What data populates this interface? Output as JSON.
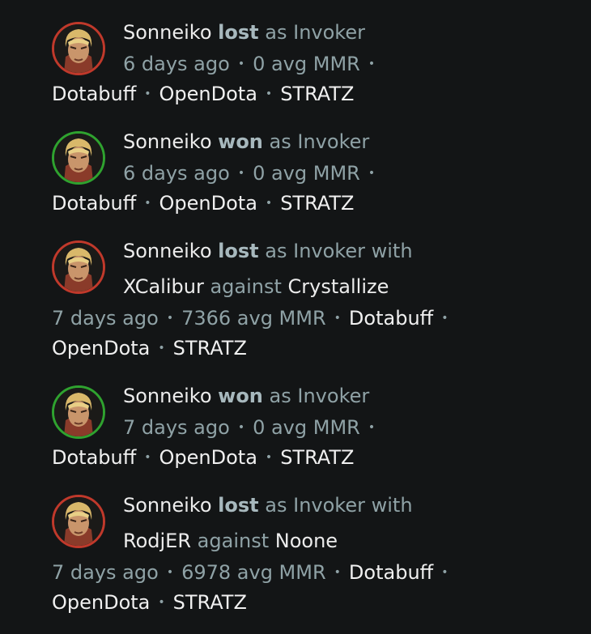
{
  "matches": [
    {
      "player": "Sonneiko",
      "result": "lost",
      "as_text": "as",
      "hero": "Invoker",
      "with_text": "",
      "ally": "",
      "against_text": "",
      "opponent": "",
      "time": "6 days ago",
      "mmr": "0 avg MMR",
      "links": [
        "Dotabuff",
        "OpenDota",
        "STRATZ"
      ]
    },
    {
      "player": "Sonneiko",
      "result": "won",
      "as_text": "as",
      "hero": "Invoker",
      "with_text": "",
      "ally": "",
      "against_text": "",
      "opponent": "",
      "time": "6 days ago",
      "mmr": "0 avg MMR",
      "links": [
        "Dotabuff",
        "OpenDota",
        "STRATZ"
      ]
    },
    {
      "player": "Sonneiko",
      "result": "lost",
      "as_text": "as",
      "hero": "Invoker",
      "with_text": "with",
      "ally": "XCalibur",
      "against_text": "against",
      "opponent": "Crystallize",
      "time": "7 days ago",
      "mmr": "7366 avg MMR",
      "links": [
        "Dotabuff",
        "OpenDota",
        "STRATZ"
      ]
    },
    {
      "player": "Sonneiko",
      "result": "won",
      "as_text": "as",
      "hero": "Invoker",
      "with_text": "",
      "ally": "",
      "against_text": "",
      "opponent": "",
      "time": "7 days ago",
      "mmr": "0 avg MMR",
      "links": [
        "Dotabuff",
        "OpenDota",
        "STRATZ"
      ]
    },
    {
      "player": "Sonneiko",
      "result": "lost",
      "as_text": "as",
      "hero": "Invoker",
      "with_text": "with",
      "ally": "RodjER",
      "against_text": "against",
      "opponent": "Noone",
      "time": "7 days ago",
      "mmr": "6978 avg MMR",
      "links": [
        "Dotabuff",
        "OpenDota",
        "STRATZ"
      ]
    }
  ],
  "colors": {
    "background": "#131516",
    "loss_ring": "#c0392b",
    "win_ring": "#2fa22f",
    "muted_text": "#8fa2a6",
    "result_text": "#a7b8bd",
    "bright_text": "#ececec"
  },
  "icons": {
    "avatar": "invoker-hero-portrait-icon",
    "separator": "middle-dot"
  }
}
